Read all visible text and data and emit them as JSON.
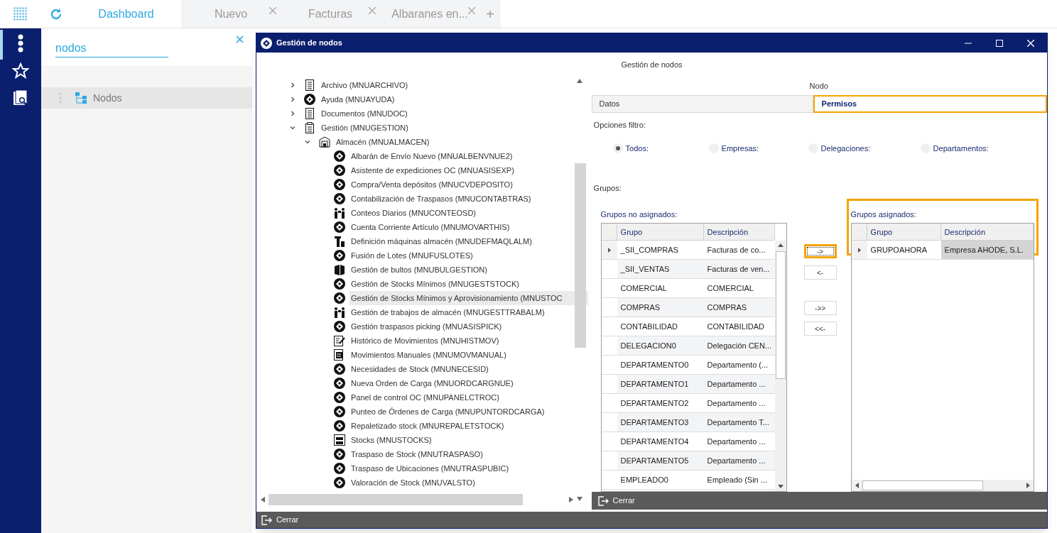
{
  "top_tabs": [
    {
      "label": "Dashboard",
      "selected": true,
      "closable": false
    },
    {
      "label": "Nuevo",
      "selected": false,
      "closable": true
    },
    {
      "label": "Facturas",
      "selected": false,
      "closable": true
    },
    {
      "label": "Albaranes en...",
      "selected": false,
      "closable": true
    }
  ],
  "add_tab": "+",
  "search": {
    "value": "nodos"
  },
  "results": [
    {
      "label": "Nodos",
      "selected": true
    }
  ],
  "window": {
    "title": "Gestión de nodos",
    "heading": "Gestión de nodos",
    "tree": [
      {
        "label": "Archivo (MNUARCHIVO)",
        "kind": "document",
        "expanded": false,
        "selected": false
      },
      {
        "label": "Ayuda (MNUAYUDA)",
        "kind": "node",
        "expanded": false,
        "selected": false
      },
      {
        "label": "Documentos (MNUDOC)",
        "kind": "document",
        "expanded": false,
        "selected": false
      },
      {
        "label": "Gestión (MNUGESTION)",
        "kind": "clipboard",
        "expanded": true,
        "selected": false,
        "children": [
          {
            "label": "Almacén (MNUALMACEN)",
            "kind": "warehouse",
            "expanded": true,
            "selected": false,
            "children": [
              {
                "label": "Albarán de Envío Nuevo (MNUALBENVNUE2)",
                "kind": "node",
                "selected": false
              },
              {
                "label": "Asistente de expediciones OC (MNUASISEXP)",
                "kind": "node",
                "selected": false
              },
              {
                "label": "Compra/Venta depósitos (MNUCVDEPOSITO)",
                "kind": "node",
                "selected": false
              },
              {
                "label": "Contabilización de Traspasos (MNUCONTABTRAS)",
                "kind": "node",
                "selected": false
              },
              {
                "label": "Conteos Diarios (MNUCONTEOSD)",
                "kind": "people",
                "selected": false
              },
              {
                "label": "Cuenta Corriente Artículo (MNUMOVARTHIS)",
                "kind": "node",
                "selected": false
              },
              {
                "label": "Definición máquinas almacén (MNUDEFMAQLALM)",
                "kind": "machine",
                "selected": false
              },
              {
                "label": "Fusión de Lotes (MNUFUSLOTES)",
                "kind": "node",
                "selected": false
              },
              {
                "label": "Gestión de bultos (MNUBULGESTION)",
                "kind": "box",
                "selected": false
              },
              {
                "label": "Gestión de Stocks Mínimos (MNUGESTSTOCK)",
                "kind": "node",
                "selected": false
              },
              {
                "label": "Gestión de Stocks Mínimos y Aprovisionamiento (MNUSTOC",
                "kind": "node",
                "selected": true
              },
              {
                "label": "Gestión de trabajos de almacén (MNUGESTTRABALM)",
                "kind": "people",
                "selected": false
              },
              {
                "label": "Gestión traspasos picking (MNUASISPICK)",
                "kind": "node",
                "selected": false
              },
              {
                "label": "Histórico de Movimientos (MNUHISTMOV)",
                "kind": "edit",
                "selected": false
              },
              {
                "label": "Movimientos Manuales (MNUMOVMANUAL)",
                "kind": "manual",
                "selected": false
              },
              {
                "label": "Necesidades de Stock (MNUNECESID)",
                "kind": "node",
                "selected": false
              },
              {
                "label": "Nueva Orden de Carga (MNUORDCARGNUE)",
                "kind": "node",
                "selected": false
              },
              {
                "label": "Panel de control OC (MNUPANELCTROC)",
                "kind": "node",
                "selected": false
              },
              {
                "label": "Punteo de Órdenes de Carga (MNUPUNTORDCARGA)",
                "kind": "node",
                "selected": false
              },
              {
                "label": "Repaletizado stock (MNUREPALETSTOCK)",
                "kind": "node",
                "selected": false
              },
              {
                "label": "Stocks (MNUSTOCKS)",
                "kind": "stocks",
                "selected": false
              },
              {
                "label": "Traspaso de Stock (MNUTRASPASO)",
                "kind": "node",
                "selected": false
              },
              {
                "label": "Traspaso de Ubicaciones (MNUTRASPUBIC)",
                "kind": "node",
                "selected": false
              },
              {
                "label": "Valoración de Stock (MNUVALSTO)",
                "kind": "node",
                "selected": false
              }
            ]
          }
        ]
      }
    ],
    "panel_title": "Nodo",
    "tabs": [
      {
        "label": "Datos",
        "selected": false,
        "highlighted": false
      },
      {
        "label": "Permisos",
        "selected": true,
        "highlighted": true
      }
    ],
    "filter_label": "Opciones filtro:",
    "filters": [
      {
        "label": "Todos:",
        "selected": true
      },
      {
        "label": "Empresas:",
        "selected": false
      },
      {
        "label": "Delegaciones:",
        "selected": false
      },
      {
        "label": "Departamentos:",
        "selected": false
      }
    ],
    "groups_label": "Grupos:",
    "unassigned": {
      "title": "Grupos no asignados:",
      "columns": [
        "Grupo",
        "Descripción"
      ],
      "rows": [
        {
          "cells": [
            "_SII_COMPRAS",
            "Facturas de co..."
          ],
          "current": true
        },
        {
          "cells": [
            "_SII_VENTAS",
            "Facturas de ven..."
          ],
          "current": false
        },
        {
          "cells": [
            "COMERCIAL",
            "COMERCIAL"
          ],
          "current": false
        },
        {
          "cells": [
            "COMPRAS",
            "COMPRAS"
          ],
          "current": false
        },
        {
          "cells": [
            "CONTABILIDAD",
            "CONTABILIDAD"
          ],
          "current": false
        },
        {
          "cells": [
            "DELEGACION0",
            "Delegación CEN..."
          ],
          "current": false
        },
        {
          "cells": [
            "DEPARTAMENTO0",
            "Departamento (..."
          ],
          "current": false
        },
        {
          "cells": [
            "DEPARTAMENTO1",
            "Departamento ..."
          ],
          "current": false
        },
        {
          "cells": [
            "DEPARTAMENTO2",
            "Departamento ..."
          ],
          "current": false
        },
        {
          "cells": [
            "DEPARTAMENTO3",
            "Departamento T..."
          ],
          "current": false
        },
        {
          "cells": [
            "DEPARTAMENTO4",
            "Departamento ..."
          ],
          "current": false
        },
        {
          "cells": [
            "DEPARTAMENTO5",
            "Departamento ..."
          ],
          "current": false
        },
        {
          "cells": [
            "EMPLEADO0",
            "Empleado (Sin ..."
          ],
          "current": false
        }
      ]
    },
    "move_buttons": [
      {
        "label": "->",
        "highlighted": true
      },
      {
        "label": "<-",
        "highlighted": false
      },
      {
        "label": "->>",
        "highlighted": false
      },
      {
        "label": "<<-",
        "highlighted": false
      }
    ],
    "assigned": {
      "title": "Grupos asignados:",
      "highlighted": true,
      "columns": [
        "Grupo",
        "Descripción"
      ],
      "rows": [
        {
          "cells": [
            "GRUPOAHORA",
            "Empresa AHODE, S.L."
          ],
          "current": true
        }
      ]
    },
    "panel_close": "Cerrar",
    "close": "Cerrar"
  }
}
